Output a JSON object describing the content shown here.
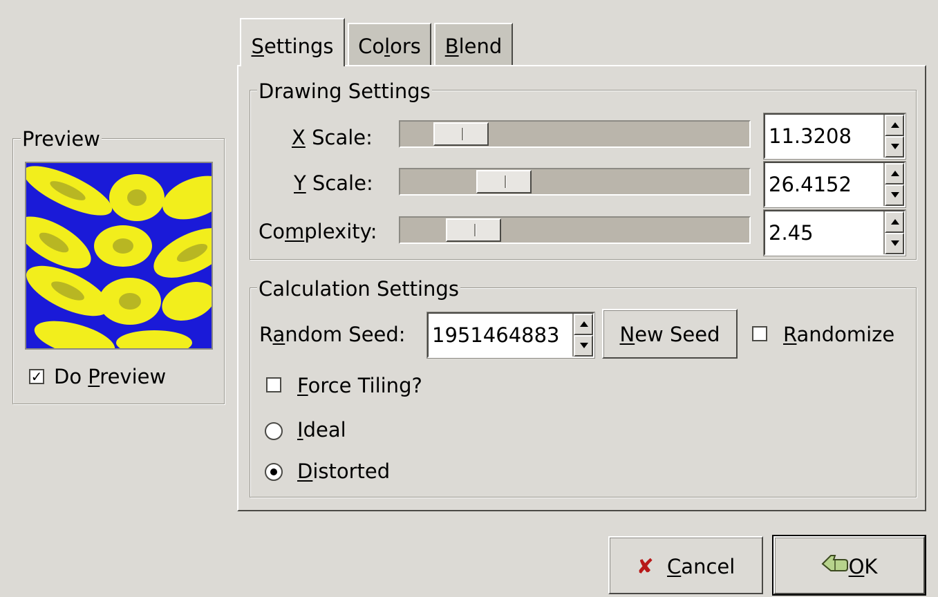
{
  "preview": {
    "title": "Preview",
    "do_preview_pre": "Do ",
    "do_preview_mnemonic": "P",
    "do_preview_post": "review",
    "do_preview_checked": true
  },
  "tabs": [
    {
      "pre": "",
      "mn": "S",
      "post": "ettings",
      "active": true
    },
    {
      "pre": "Co",
      "mn": "l",
      "post": "ors",
      "active": false
    },
    {
      "pre": "",
      "mn": "B",
      "post": "lend",
      "active": false
    }
  ],
  "drawing": {
    "title": "Drawing Settings",
    "x_scale": {
      "mn": "X",
      "post": " Scale:",
      "value": "11.3208",
      "level_fraction": 0.11
    },
    "y_scale": {
      "mn": "Y",
      "post": " Scale:",
      "value": "26.4152",
      "level_fraction": 0.26
    },
    "complexity": {
      "pre": "Co",
      "mn": "m",
      "post": "plexity:",
      "value": "2.45",
      "level_fraction": 0.14
    }
  },
  "calc": {
    "title": "Calculation Settings",
    "seed_pre": "R",
    "seed_mn": "a",
    "seed_post": "ndom Seed:",
    "seed_value": "1951464883",
    "new_seed_mn": "N",
    "new_seed_post": "ew Seed",
    "randomize_mn": "R",
    "randomize_post": "andomize",
    "randomize_checked": false,
    "force_tiling_mn": "F",
    "force_tiling_post": "orce Tiling?",
    "force_tiling_checked": false,
    "ideal_mn": "I",
    "ideal_post": "deal",
    "distorted_mn": "D",
    "distorted_post": "istorted",
    "selected_mode": "Distorted"
  },
  "buttons": {
    "cancel_mn": "C",
    "cancel_post": "ancel",
    "ok_mn": "O",
    "ok_post": "K"
  },
  "colors": {
    "preview_background": "#1a1ad8",
    "preview_pattern": "#f2ee1c"
  }
}
